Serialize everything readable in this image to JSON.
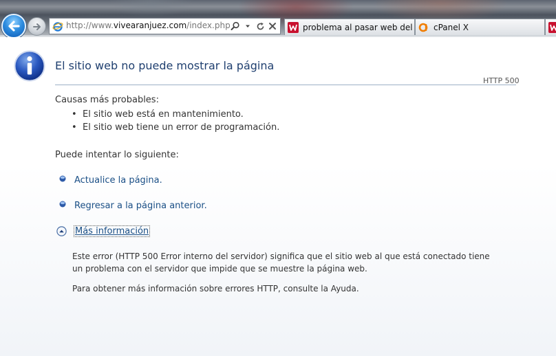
{
  "browser": {
    "address": {
      "url_prefix": "http://www.",
      "url_host": "vivearanjuez.com",
      "url_path": "/index.php"
    },
    "tabs": [
      {
        "label": "problema al pasar web del se..."
      },
      {
        "label": "cPanel X"
      },
      {
        "label": ""
      }
    ],
    "icons": {
      "back": "back-arrow-icon",
      "forward": "forward-arrow-icon",
      "search": "search-icon",
      "refresh": "refresh-icon",
      "stop": "stop-icon"
    }
  },
  "page": {
    "title": "El sitio web no puede mostrar la página",
    "error_code": "HTTP 500",
    "causes_heading": "Causas más probables:",
    "causes": [
      "El sitio web está en mantenimiento.",
      "El sitio web tiene un error de programación."
    ],
    "try_heading": "Puede intentar lo siguiente:",
    "actions": [
      "Actualice la página.",
      "Regresar a la página anterior."
    ],
    "more_info_label": "Más información",
    "details": [
      "Este error (HTTP 500 Error interno del servidor) significa que el sitio web al que está conectado tiene un problema con el servidor que impide que se muestre la página web.",
      "Para obtener más información sobre errores HTTP, consulte la Ayuda."
    ]
  },
  "colors": {
    "title": "#1f3f6f",
    "link": "#1a4f86",
    "rule": "#9cb0c6"
  }
}
